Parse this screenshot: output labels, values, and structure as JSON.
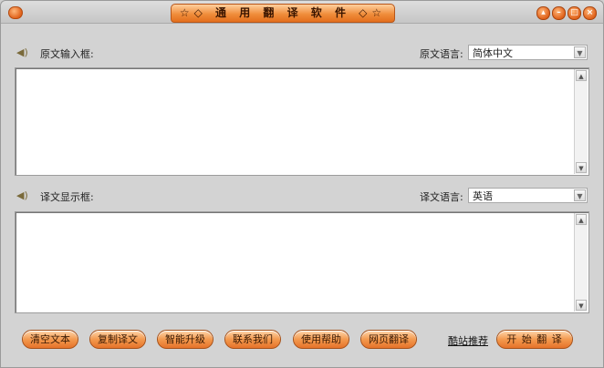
{
  "window": {
    "title": "☆◇ 通 用 翻 译 软 件 ◇☆"
  },
  "source": {
    "label": "原文输入框:",
    "lang_label": "原文语言:",
    "lang_value": "简体中文",
    "text": ""
  },
  "target": {
    "label": "译文显示框:",
    "lang_label": "译文语言:",
    "lang_value": "英语",
    "text": ""
  },
  "buttons": {
    "clear": "清空文本",
    "copy": "复制译文",
    "upgrade": "智能升级",
    "contact": "联系我们",
    "help": "使用帮助",
    "web": "网页翻译",
    "recommend": "酷站推荐",
    "start": "开 始 翻 译"
  },
  "colors": {
    "accent": "#f08e3c",
    "background": "#d3d3d3"
  }
}
